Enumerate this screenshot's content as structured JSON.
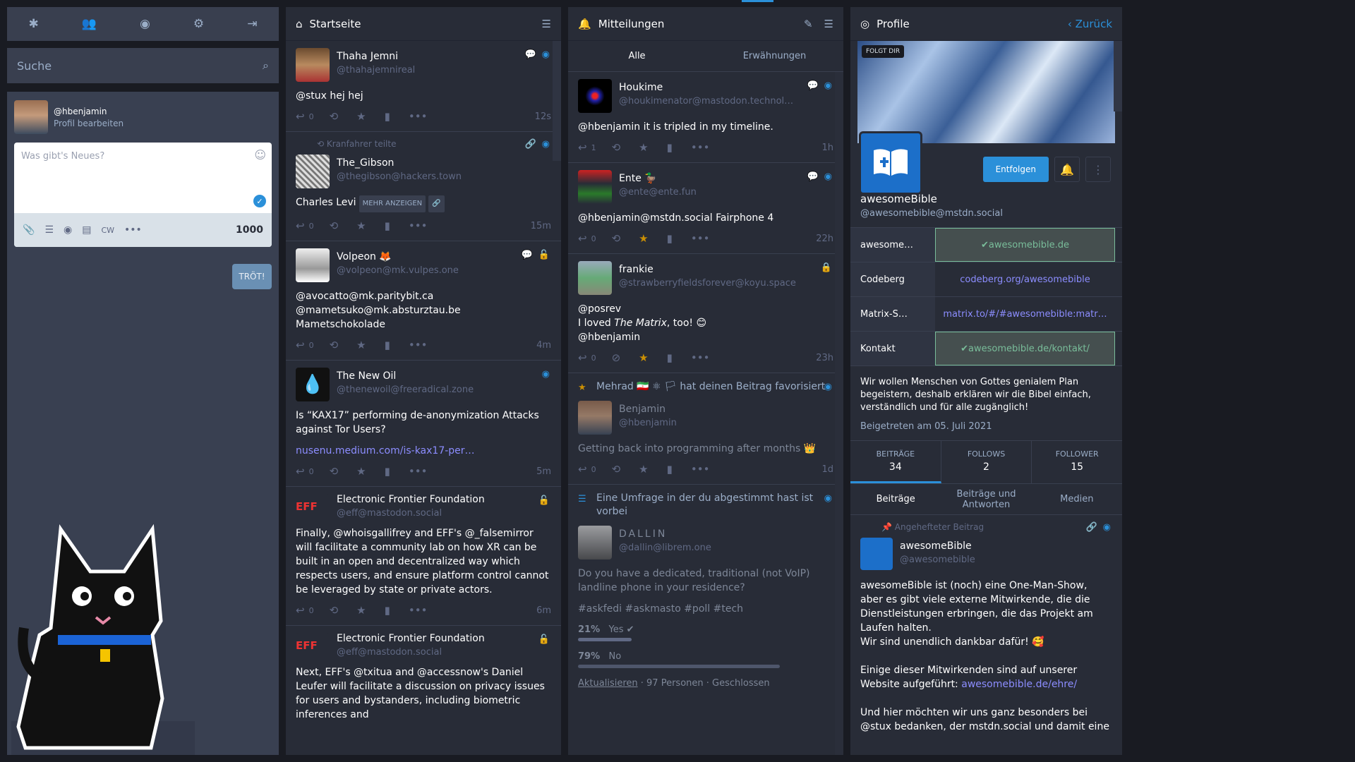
{
  "nav": {
    "icons": [
      "asterisk-icon",
      "people-icon",
      "globe-icon",
      "cogs-icon",
      "logout-icon"
    ]
  },
  "search": {
    "placeholder": "Suche"
  },
  "compose": {
    "account": "@hbenjamin",
    "edit": "Profil bearbeiten",
    "placeholder": "Was gibt's Neues?",
    "cw": "CW",
    "counter": "1000",
    "publish": "TRÖT!"
  },
  "home": {
    "title": "Startseite",
    "statuses": [
      {
        "name": "Thaha Jemni",
        "acct": "@thahajemnireal",
        "text": "@stux hej hej",
        "replies": "0",
        "time": "12s"
      },
      {
        "prepend": "Kranfahrer teilte",
        "name": "The_Gibson",
        "acct": "@thegibson@hackers.town",
        "text": "Charles Levi",
        "more": "MEHR ANZEIGEN",
        "replies": "0",
        "time": "15m"
      },
      {
        "name": "Volpeon 🦊",
        "acct": "@volpeon@mk.vulpes.one",
        "text": "@avocatto@mk.paritybit.ca",
        "text2": "@mametsuko@mk.absturztau.be Mametschokolade",
        "replies": "0",
        "time": "4m"
      },
      {
        "name": "The New Oil",
        "acct": "@thenewoil@freeradical.zone",
        "text": "Is “KAX17” performing de-anonymization Attacks against Tor Users?",
        "link": "nusenu.medium.com/is-kax17-per…",
        "replies": "0",
        "time": "5m"
      },
      {
        "name": "Electronic Frontier Foundation",
        "acct": "@eff@mastodon.social",
        "text": "Finally, @whoisgallifrey and EFF's @_falsemirror will facilitate a community lab on how XR can be built in an open and decentralized way which respects users, and ensure platform control cannot be leveraged by state or private actors.",
        "replies": "0",
        "time": "6m"
      },
      {
        "name": "Electronic Frontier Foundation",
        "acct": "@eff@mastodon.social",
        "text": "Next, EFF's @txitua and @accessnow's Daniel Leufer will facilitate a discussion on privacy issues for users and bystanders, including biometric inferences and"
      }
    ]
  },
  "notifications": {
    "title": "Mitteilungen",
    "tabs": [
      "Alle",
      "Erwähnungen"
    ],
    "items": [
      {
        "name": "Houkime",
        "acct": "@houkimenator@mastodon.technol…",
        "text": "@hbenjamin it is tripled in my timeline.",
        "replies": "1",
        "time": "1h"
      },
      {
        "name": "Ente 🦆",
        "acct": "@ente@ente.fun",
        "text": "@hbenjamin@mstdn.social Fairphone 4",
        "replies": "0",
        "time": "22h"
      },
      {
        "name": "frankie",
        "acct": "@strawberryfieldsforever@koyu.space",
        "text": "@posrev",
        "text2a": "I loved ",
        "text2b": "The Matrix",
        "text2c": ", too! 😊",
        "text3": "@hbenjamin",
        "replies": "0",
        "time": "23h"
      },
      {
        "who": "Mehrad 🇮🇷 ⚛ 🏳 hat deinen Beitrag favorisiert",
        "name": "Benjamin",
        "acct": "@hbenjamin",
        "text": "Getting back into programming after months 👑",
        "replies": "0",
        "time": "1d"
      },
      {
        "who": "Eine Umfrage in der du abgestimmt hast ist vorbei",
        "name": "DALLIN",
        "acct": "@dallin@librem.one",
        "text": "Do you have a dedicated, traditional (not VoIP) landline phone in your residence?",
        "tags": "#askfedi #askmasto #poll #tech",
        "poll": [
          {
            "pct": "21%",
            "label": "Yes",
            "frac": 0.21
          },
          {
            "pct": "79%",
            "label": "No",
            "frac": 0.79
          }
        ],
        "refresh": "Aktualisieren",
        "meta": " · 97 Personen · Geschlossen"
      }
    ]
  },
  "profile": {
    "title": "Profile",
    "back": "Zurück",
    "follows_you": "FOLGT DIR",
    "unfollow": "Entfolgen",
    "name": "awesomeBible",
    "acct": "@awesomebible@mstdn.social",
    "fields": [
      {
        "k": "awesome…",
        "v": "awesomebible.de",
        "verified": true
      },
      {
        "k": "Codeberg",
        "v": "codeberg.org/awesomebible",
        "verified": false
      },
      {
        "k": "Matrix-S…",
        "v": "matrix.to/#/#awesomebible:matr…",
        "verified": false
      },
      {
        "k": "Kontakt",
        "v": "awesomebible.de/kontakt/",
        "verified": true
      }
    ],
    "bio": "Wir wollen Menschen von Gottes genialem Plan begeistern, deshalb erklären wir die Bibel einfach, verständlich und für alle zugänglich!",
    "joined": "Beigetreten am 05. Juli 2021",
    "counters": [
      {
        "label": "BEITRÄGE",
        "value": "34"
      },
      {
        "label": "FOLLOWS",
        "value": "2"
      },
      {
        "label": "FOLLOWER",
        "value": "15"
      }
    ],
    "tabs": [
      "Beiträge",
      "Beiträge und Antworten",
      "Medien"
    ],
    "pinned": "Angehefteter Beitrag",
    "post": {
      "name": "awesomeBible",
      "acct": "@awesomebible",
      "p1": "awesomeBible ist (noch) eine One-Man-Show, aber es gibt viele externe Mitwirkende, die die Dienstleistungen erbringen, die das Projekt am Laufen halten.",
      "p1b": "Wir sind unendlich dankbar dafür! 🥰",
      "p2": "Einige dieser Mitwirkenden sind auf unserer Website aufgeführt: ",
      "p2link": "awesomebible.de/ehre/",
      "p3": "Und hier möchten wir uns ganz besonders bei @stux bedanken, der mstdn.social und damit eine"
    }
  }
}
